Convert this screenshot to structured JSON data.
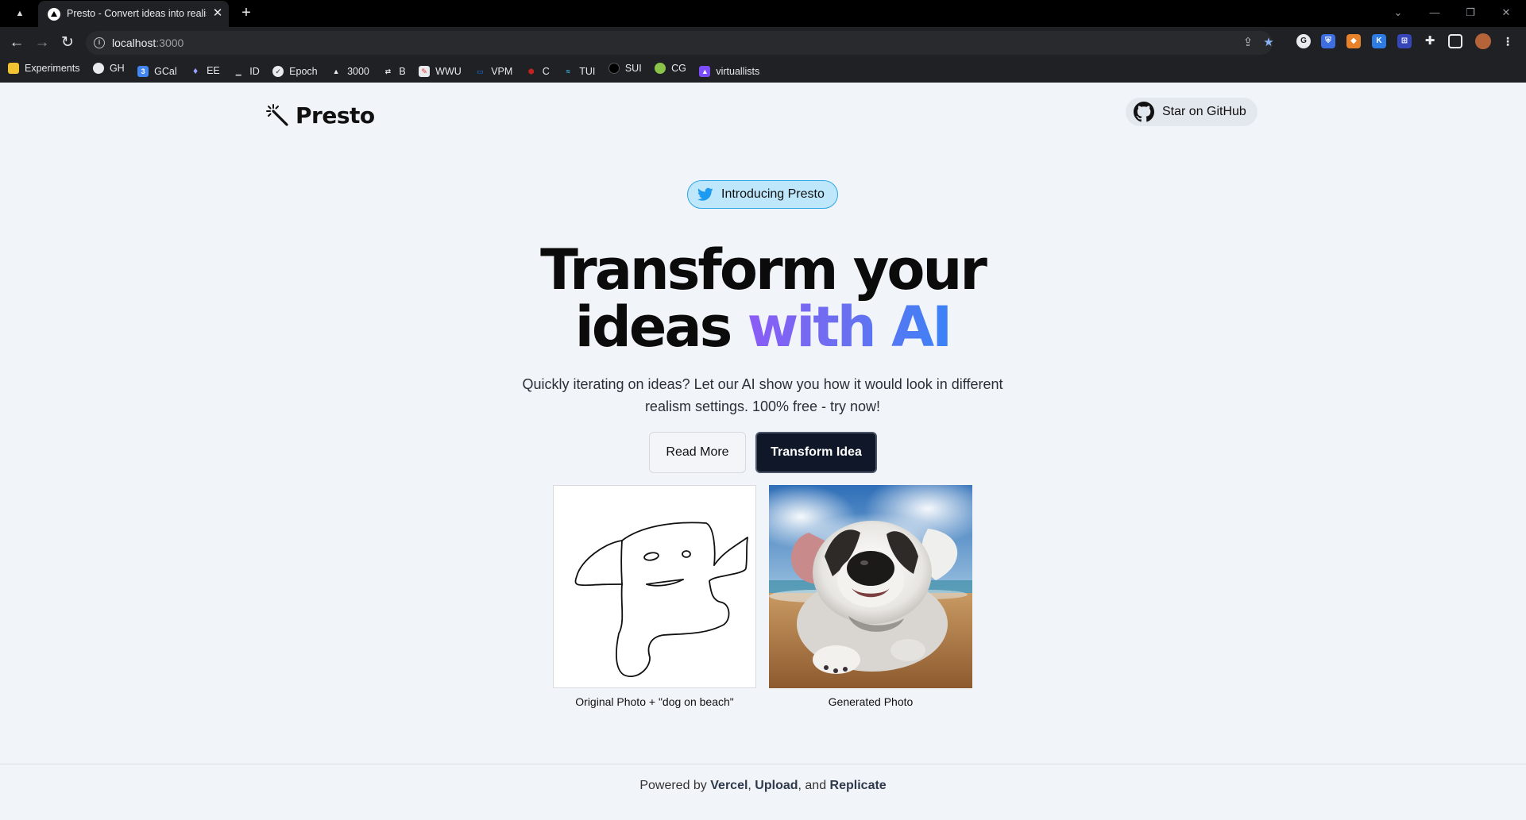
{
  "browser": {
    "tab_title": "Presto - Convert ideas into realis",
    "url_host": "localhost",
    "url_port": ":3000",
    "bookmarks": [
      "Experiments",
      "GH",
      "GCal",
      "EE",
      "ID",
      "Epoch",
      "3000",
      "B",
      "WWU",
      "VPM",
      "C",
      "TUI",
      "SUI",
      "CG",
      "virtuallists"
    ]
  },
  "header": {
    "logo_text": "Presto",
    "star_label": "Star on GitHub"
  },
  "hero": {
    "intro_label": "Introducing Presto",
    "headline_line1": "Transform your",
    "headline_plain": "ideas ",
    "headline_accent": "with AI",
    "subtext": "Quickly iterating on ideas? Let our AI show you how it would look in different realism settings. 100% free - try now!",
    "read_more": "Read More",
    "transform": "Transform Idea"
  },
  "gallery": {
    "original_caption": "Original Photo + \"dog on beach\"",
    "generated_caption": "Generated Photo"
  },
  "footer": {
    "prefix": "Powered by ",
    "vercel": "Vercel",
    "sep1": ", ",
    "upload": "Upload",
    "sep2": ", and ",
    "replicate": "Replicate"
  },
  "colors": {
    "accent_start": "#8b5cf6",
    "accent_end": "#3b82f6",
    "primary_button": "#0f1729",
    "twitter_blue": "#1d9bf0",
    "page_bg": "#f1f4f9"
  }
}
